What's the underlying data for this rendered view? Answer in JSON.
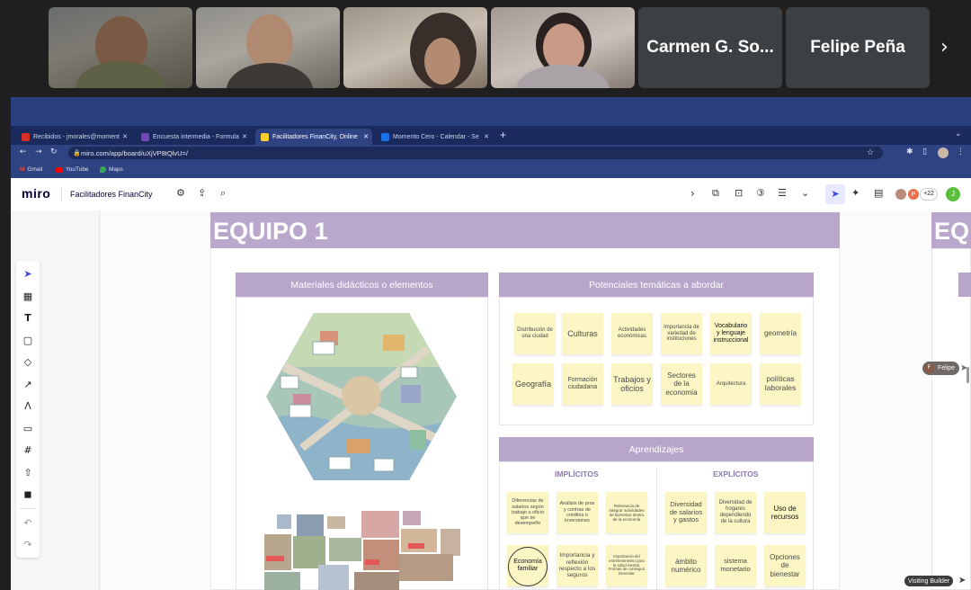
{
  "meeting": {
    "participants": [
      {
        "name": "Carmen G. So..."
      },
      {
        "name": "Felipe Peña"
      }
    ],
    "next_icon": "chevron-right-icon"
  },
  "browser": {
    "tabs": [
      {
        "label": "Recibidos - jmorales@moment",
        "color": "#d93025"
      },
      {
        "label": "Encuesta intermedia - Formula",
        "color": "#7248b9"
      },
      {
        "label": "Facilitadores FinanCity, Online",
        "color": "#ffd02f"
      },
      {
        "label": "Momento Cero - Calendar - Se",
        "color": "#1a73e8"
      }
    ],
    "url": "miro.com/app/board/uXjVP8tQlvU=/",
    "bookmarks": [
      {
        "label": "Gmail"
      },
      {
        "label": "YouTube"
      },
      {
        "label": "Maps"
      }
    ]
  },
  "miro": {
    "logo": "miro",
    "board_name": "Facilitadores FinanCity",
    "collaborator_count": "+22",
    "avatar_p": "P",
    "avatar_j": "J",
    "cursor_label": "Felipe",
    "cursor_initial": "F",
    "visiting_label": "Visiting Builder"
  },
  "board": {
    "frame_title": "EQUIPO 1",
    "frame_title_next": "EQ",
    "materials": {
      "title": "Materiales didácticos o elementos"
    },
    "topics": {
      "title": "Potenciales temáticas a abordar",
      "notes": [
        "Distribución de una ciudad",
        "Culturas",
        "Actividades económicas",
        "Importancia de variedad de instituciones",
        "Vocabulario y lenguaje instruccional",
        "geometría",
        "Geografía",
        "Formación ciudadana",
        "Trabajos y oficios",
        "Sectores de la economía",
        "Arquitectura",
        "políticas laborales"
      ]
    },
    "learning": {
      "title": "Aprendizajes",
      "implicit_label": "IMPLÍCITOS",
      "explicit_label": "EXPLÍCITOS",
      "implicit_notes": [
        "Diferencias de salarios según trabajo u oficio que se desempeñe",
        "Análisis de pros y contras de créditos o inversiones",
        "Relevancia de integrar actividades de bienestar dentro de la economía",
        "Economía familiar",
        "Importancia y reflexión respecto a los seguros",
        "Importancia del entretenimiento para la salud mental. Formas de conseguir bienestar"
      ],
      "explicit_notes": [
        "Diversidad de salarios y gastos",
        "Diversidad de hogares dependiendo de la cultura",
        "Uso de recursos",
        "ámbito numérico",
        "sistema monetario",
        "Opciones de bienestar"
      ]
    }
  }
}
